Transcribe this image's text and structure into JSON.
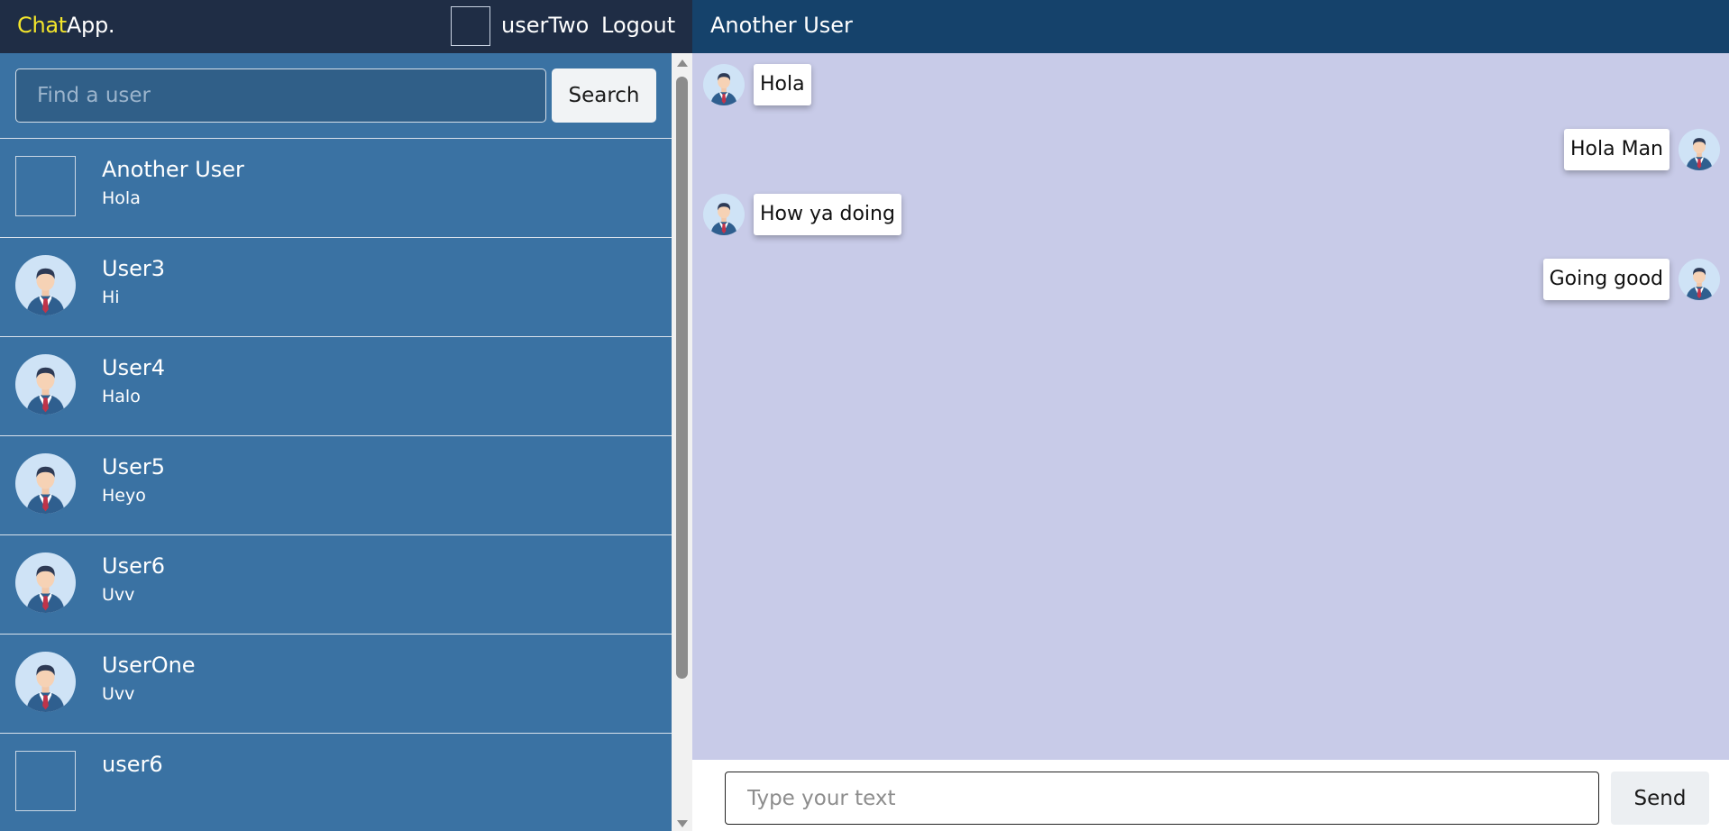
{
  "app": {
    "logo_accent": "Chat",
    "logo_rest": "App.",
    "current_user": "userTwo",
    "logout_label": "Logout"
  },
  "search": {
    "placeholder": "Find a user",
    "button_label": "Search"
  },
  "users": [
    {
      "name": "Another User",
      "preview": "Hola",
      "avatar": "blank"
    },
    {
      "name": "User3",
      "preview": "Hi",
      "avatar": "person-avatar-icon"
    },
    {
      "name": "User4",
      "preview": "Halo",
      "avatar": "person-avatar-icon"
    },
    {
      "name": "User5",
      "preview": "Heyo",
      "avatar": "person-avatar-icon"
    },
    {
      "name": "User6",
      "preview": "Uvv",
      "avatar": "person-avatar-icon"
    },
    {
      "name": "UserOne",
      "preview": "Uvv",
      "avatar": "person-avatar-icon"
    },
    {
      "name": "user6",
      "preview": "",
      "avatar": "blank"
    }
  ],
  "chat": {
    "title": "Another User",
    "messages": [
      {
        "text": "Hola",
        "direction": "incoming"
      },
      {
        "text": "Hola Man",
        "direction": "outgoing"
      },
      {
        "text": "How ya doing",
        "direction": "incoming"
      },
      {
        "text": "Going good",
        "direction": "outgoing"
      }
    ],
    "input_placeholder": "Type your text",
    "send_label": "Send"
  },
  "colors": {
    "header_left": "#1f2d45",
    "header_right": "#15426b",
    "sidebar": "#3a72a3",
    "chat_background": "#c8cbe8",
    "logo_accent": "#f3e52b"
  }
}
